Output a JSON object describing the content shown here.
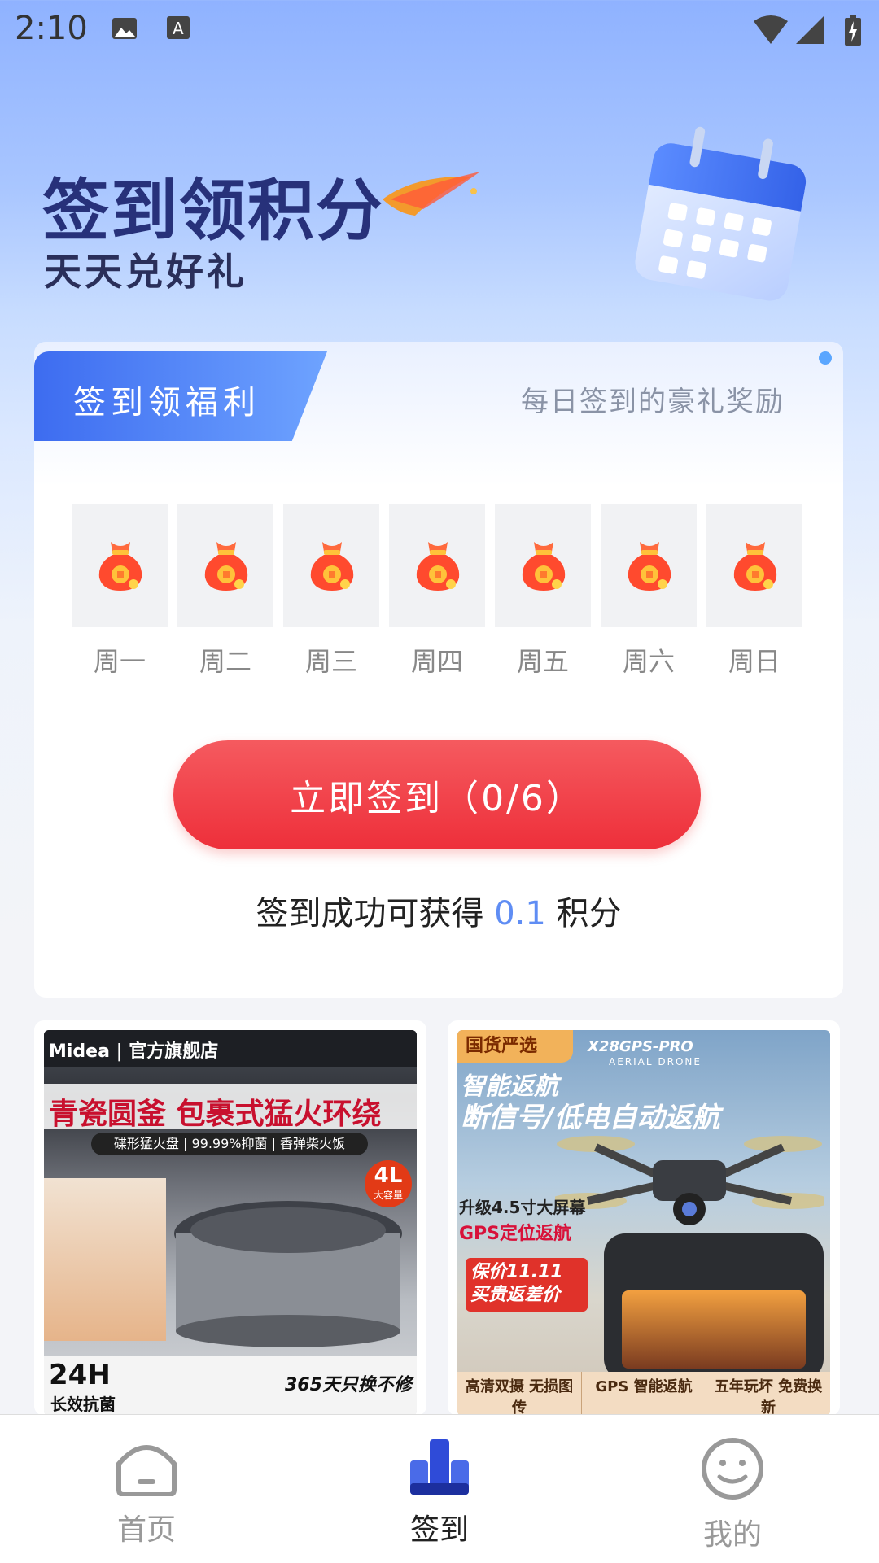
{
  "status_bar": {
    "time": "2:10"
  },
  "hero": {
    "title": "签到领积分",
    "subtitle": "天天兑好礼"
  },
  "card": {
    "tab_label": "签到领福利",
    "subtitle": "每日签到的豪礼奖励",
    "days": [
      "周一",
      "周二",
      "周三",
      "周四",
      "周五",
      "周六",
      "周日"
    ],
    "button_label": "立即签到（0/6）",
    "reward_prefix": "签到成功可获得",
    "reward_value": "0.1",
    "reward_suffix": "积分"
  },
  "products": [
    {
      "badge": "Midea | 官方旗舰店",
      "headline": "青瓷圆釜 包裹式猛火环绕",
      "features": "碟形猛火盘 | 99.99%抑菌 | 香弹柴火饭",
      "capacity": "4L",
      "capacity_label": "大容量",
      "corner_left": "24H",
      "corner_left_sub": "长效抗菌",
      "corner_right": "365天只换不修"
    },
    {
      "badge": "国货严选",
      "model": "X28GPS-PRO",
      "model_sub": "AERIAL DRONE",
      "headline_1": "智能返航",
      "headline_2": "断信号/低电自动返航",
      "screen_text": "升级4.5寸大屏幕",
      "gps_text": "GPS定位返航",
      "promo": "保价11.11 买贵返差价",
      "features": [
        "高清双摄 无损图传",
        "GPS 智能返航",
        "五年玩坏 免费换新"
      ]
    }
  ],
  "nav": [
    {
      "label": "首页",
      "icon": "home-icon",
      "active": false
    },
    {
      "label": "签到",
      "icon": "checkin-icon",
      "active": true
    },
    {
      "label": "我的",
      "icon": "profile-icon",
      "active": false
    }
  ],
  "colors": {
    "accent": "#3d6cf0",
    "button": "#ee2f3a",
    "reward": "#5f8df4",
    "nav_active": "#2f4bd8"
  }
}
